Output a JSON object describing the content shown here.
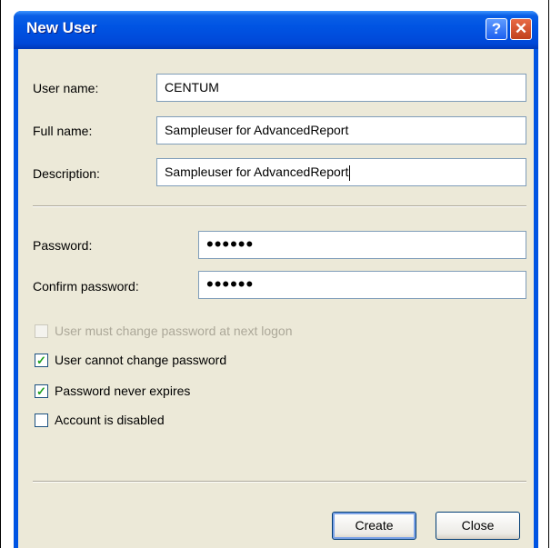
{
  "window": {
    "title": "New User"
  },
  "titlebar": {
    "help_glyph": "?",
    "close_glyph": "✕"
  },
  "form": {
    "username_label": "User name:",
    "username_value": "CENTUM",
    "fullname_label": "Full name:",
    "fullname_value": "Sampleuser for AdvancedReport",
    "description_label": "Description:",
    "description_value": "Sampleuser for AdvancedReport",
    "password_label": "Password:",
    "password_value": "••••••",
    "confirm_label": "Confirm password:",
    "confirm_value": "••••••"
  },
  "options": [
    {
      "label": "User must change password at next logon",
      "checked": false,
      "enabled": false
    },
    {
      "label": "User cannot change password",
      "checked": true,
      "enabled": true
    },
    {
      "label": "Password never expires",
      "checked": true,
      "enabled": true
    },
    {
      "label": "Account is disabled",
      "checked": false,
      "enabled": true
    }
  ],
  "buttons": {
    "create_label": "Create",
    "close_label": "Close"
  },
  "colors": {
    "titlebar": "#0054e3",
    "dialog_bg": "#ece9d8",
    "check_mark": "#21a121"
  }
}
